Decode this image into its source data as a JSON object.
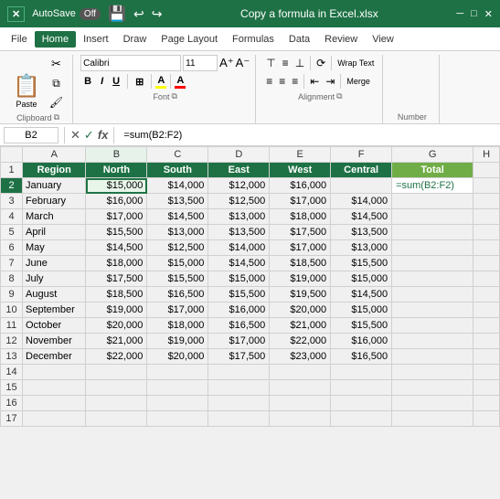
{
  "titleBar": {
    "appLogo": "X",
    "autoSaveLabel": "AutoSave",
    "toggleState": "Off",
    "undoIcon": "↩",
    "redoIcon": "↪",
    "fileName": "Copy a formula in Excel.xlsx",
    "chevron": "▾"
  },
  "menuBar": {
    "items": [
      "File",
      "Home",
      "Insert",
      "Draw",
      "Page Layout",
      "Formulas",
      "Data",
      "Review",
      "View"
    ],
    "activeIndex": 1
  },
  "ribbon": {
    "clipboard": {
      "label": "Clipboard",
      "pasteLabel": "Paste"
    },
    "font": {
      "label": "Font",
      "fontName": "",
      "fontSize": "11",
      "boldLabel": "B",
      "italicLabel": "I",
      "underlineLabel": "U"
    },
    "alignment": {
      "label": "Alignment",
      "wrapText": "Wrap Text",
      "merge": "Merge"
    },
    "number": {
      "label": "Number"
    }
  },
  "formulaBar": {
    "nameBox": "B2",
    "cancelIcon": "✕",
    "confirmIcon": "✓",
    "fxIcon": "fx",
    "formula": "=sum(B2:F2)"
  },
  "sheet": {
    "colHeaders": [
      "",
      "A",
      "B",
      "C",
      "D",
      "E",
      "F",
      "G",
      "H"
    ],
    "headers": {
      "region": "Region",
      "north": "North",
      "south": "South",
      "east": "East",
      "west": "West",
      "central": "Central",
      "total": "Total"
    },
    "rows": [
      {
        "month": "January",
        "north": "$15,000",
        "south": "$14,000",
        "east": "$12,000",
        "west": "$16,000",
        "central": "",
        "formula": "=sum(B2:F2)"
      },
      {
        "month": "February",
        "north": "$16,000",
        "south": "$13,500",
        "east": "$12,500",
        "west": "$17,000",
        "central": "$14,000",
        "formula": ""
      },
      {
        "month": "March",
        "north": "$17,000",
        "south": "$14,500",
        "east": "$13,000",
        "west": "$18,000",
        "central": "$14,500",
        "formula": ""
      },
      {
        "month": "April",
        "north": "$15,500",
        "south": "$13,000",
        "east": "$13,500",
        "west": "$17,500",
        "central": "$13,500",
        "formula": ""
      },
      {
        "month": "May",
        "north": "$14,500",
        "south": "$12,500",
        "east": "$14,000",
        "west": "$17,000",
        "central": "$13,000",
        "formula": ""
      },
      {
        "month": "June",
        "north": "$18,000",
        "south": "$15,000",
        "east": "$14,500",
        "west": "$18,500",
        "central": "$15,500",
        "formula": ""
      },
      {
        "month": "July",
        "north": "$17,500",
        "south": "$15,500",
        "east": "$15,000",
        "west": "$19,000",
        "central": "$15,000",
        "formula": ""
      },
      {
        "month": "August",
        "north": "$18,500",
        "south": "$16,500",
        "east": "$15,500",
        "west": "$19,500",
        "central": "$14,500",
        "formula": ""
      },
      {
        "month": "September",
        "north": "$19,000",
        "south": "$17,000",
        "east": "$16,000",
        "west": "$20,000",
        "central": "$15,000",
        "formula": ""
      },
      {
        "month": "October",
        "north": "$20,000",
        "south": "$18,000",
        "east": "$16,500",
        "west": "$21,000",
        "central": "$15,500",
        "formula": ""
      },
      {
        "month": "November",
        "north": "$21,000",
        "south": "$19,000",
        "east": "$17,000",
        "west": "$22,000",
        "central": "$16,000",
        "formula": ""
      },
      {
        "month": "December",
        "north": "$22,000",
        "south": "$20,000",
        "east": "$17,500",
        "west": "$23,000",
        "central": "$16,500",
        "formula": ""
      }
    ],
    "emptyRows": [
      14,
      15,
      16,
      17
    ]
  }
}
